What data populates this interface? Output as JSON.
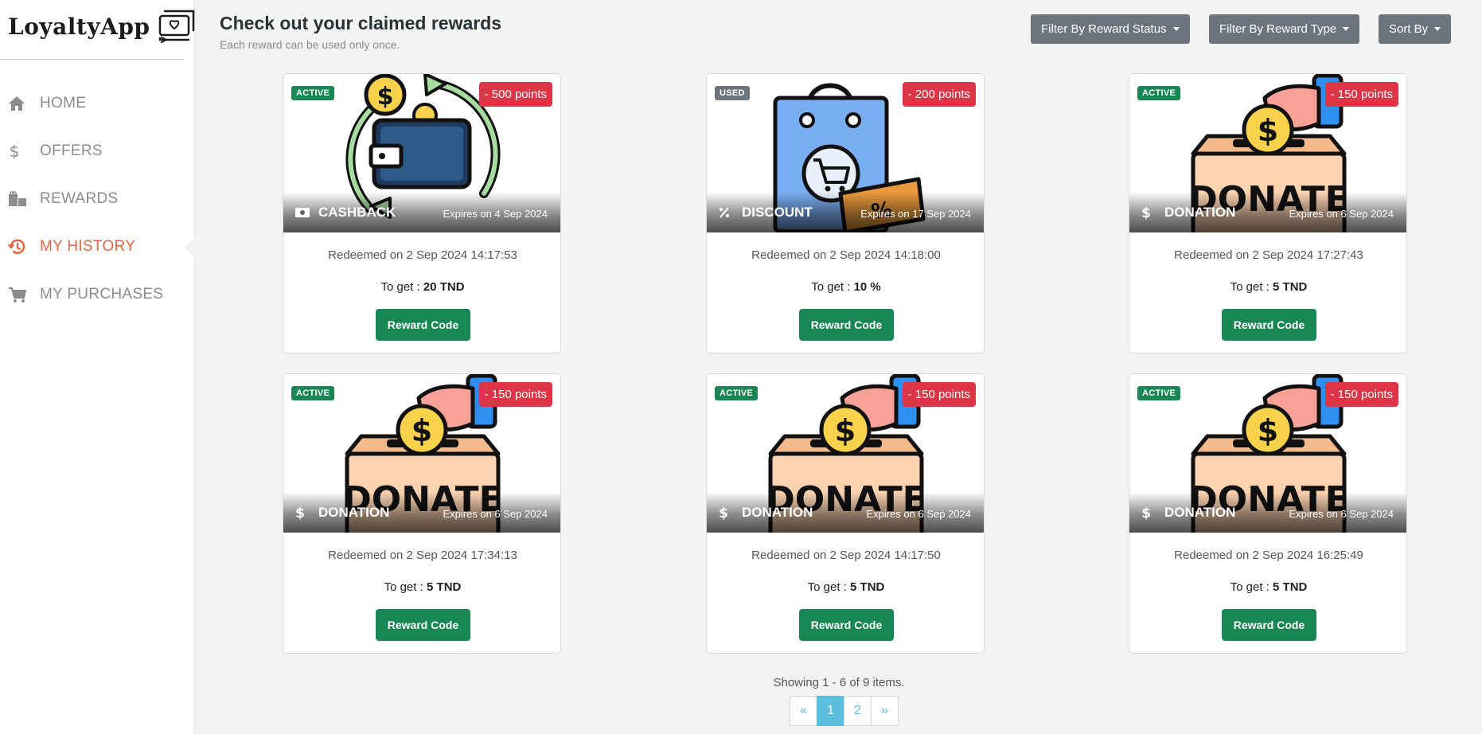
{
  "app": {
    "name": "LoyaltyApp"
  },
  "sidebar": {
    "items": [
      {
        "label": "HOME",
        "icon": "home-icon",
        "active": false
      },
      {
        "label": "OFFERS",
        "icon": "dollar-icon",
        "active": false
      },
      {
        "label": "REWARDS",
        "icon": "gift-icon",
        "active": false
      },
      {
        "label": "MY HISTORY",
        "icon": "history-icon",
        "active": true
      },
      {
        "label": "MY PURCHASES",
        "icon": "cart-icon",
        "active": false
      }
    ]
  },
  "header": {
    "title": "Check out your claimed rewards",
    "subtitle": "Each reward can be used only once.",
    "filters": {
      "status": "Filter By Reward Status",
      "type": "Filter By Reward Type",
      "sort": "Sort By"
    }
  },
  "rewards": [
    {
      "status": "ACTIVE",
      "points": "- 500 points",
      "type": "CASHBACK",
      "expires": "Expires on 4 Sep 2024",
      "redeemed": "Redeemed on 2 Sep 2024 14:17:53",
      "to_get_label": "To get :",
      "to_get_value": "20 TND",
      "button": "Reward Code",
      "image": "cashback-wallet-illustration"
    },
    {
      "status": "USED",
      "points": "- 200 points",
      "type": "DISCOUNT",
      "expires": "Expires on 17 Sep 2024",
      "redeemed": "Redeemed on 2 Sep 2024 14:18:00",
      "to_get_label": "To get :",
      "to_get_value": "10 %",
      "button": "Reward Code",
      "image": "shopping-bag-coupon-illustration"
    },
    {
      "status": "ACTIVE",
      "points": "- 150 points",
      "type": "DONATION",
      "expires": "Expires on 6 Sep 2024",
      "redeemed": "Redeemed on 2 Sep 2024 17:27:43",
      "to_get_label": "To get :",
      "to_get_value": "5 TND",
      "button": "Reward Code",
      "image": "donate-box-illustration"
    },
    {
      "status": "ACTIVE",
      "points": "- 150 points",
      "type": "DONATION",
      "expires": "Expires on 6 Sep 2024",
      "redeemed": "Redeemed on 2 Sep 2024 17:34:13",
      "to_get_label": "To get :",
      "to_get_value": "5 TND",
      "button": "Reward Code",
      "image": "donate-box-illustration"
    },
    {
      "status": "ACTIVE",
      "points": "- 150 points",
      "type": "DONATION",
      "expires": "Expires on 6 Sep 2024",
      "redeemed": "Redeemed on 2 Sep 2024 14:17:50",
      "to_get_label": "To get :",
      "to_get_value": "5 TND",
      "button": "Reward Code",
      "image": "donate-box-illustration"
    },
    {
      "status": "ACTIVE",
      "points": "- 150 points",
      "type": "DONATION",
      "expires": "Expires on 6 Sep 2024",
      "redeemed": "Redeemed on 2 Sep 2024 16:25:49",
      "to_get_label": "To get :",
      "to_get_value": "5 TND",
      "button": "Reward Code",
      "image": "donate-box-illustration"
    }
  ],
  "pagination": {
    "summary": "Showing 1 - 6 of 9 items.",
    "prev": "«",
    "pages": [
      "1",
      "2"
    ],
    "current": "1",
    "next": "»"
  },
  "colors": {
    "accent": "#e4663f",
    "active_badge": "#198754",
    "used_badge": "#6c757d",
    "points_badge": "#dc3545",
    "filter_button": "#6c757d",
    "reward_button": "#198754",
    "pagination": "#5bc0de"
  }
}
